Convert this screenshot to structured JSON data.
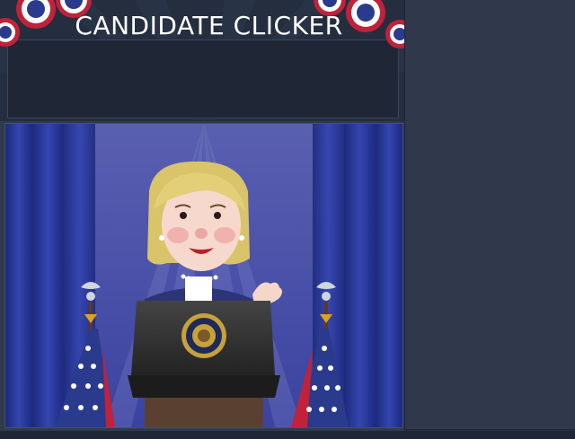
{
  "game": {
    "title": "CANDIDATE CLICKER"
  },
  "colors": {
    "background": "#283143",
    "header": "#1f2636",
    "stage_curtain": "#2c3a9a",
    "bunting_red": "#c0223a",
    "bunting_blue": "#2a3a8c",
    "podium": "#2b2b2b",
    "seal_gold": "#c8a13a"
  },
  "icons": {
    "bunting": "patriotic-bunting-icon",
    "candidate": "candidate-character",
    "podium": "podium-icon",
    "seal": "presidential-seal-icon",
    "flag": "american-flag-icon",
    "eagle": "eagle-finial-icon"
  }
}
